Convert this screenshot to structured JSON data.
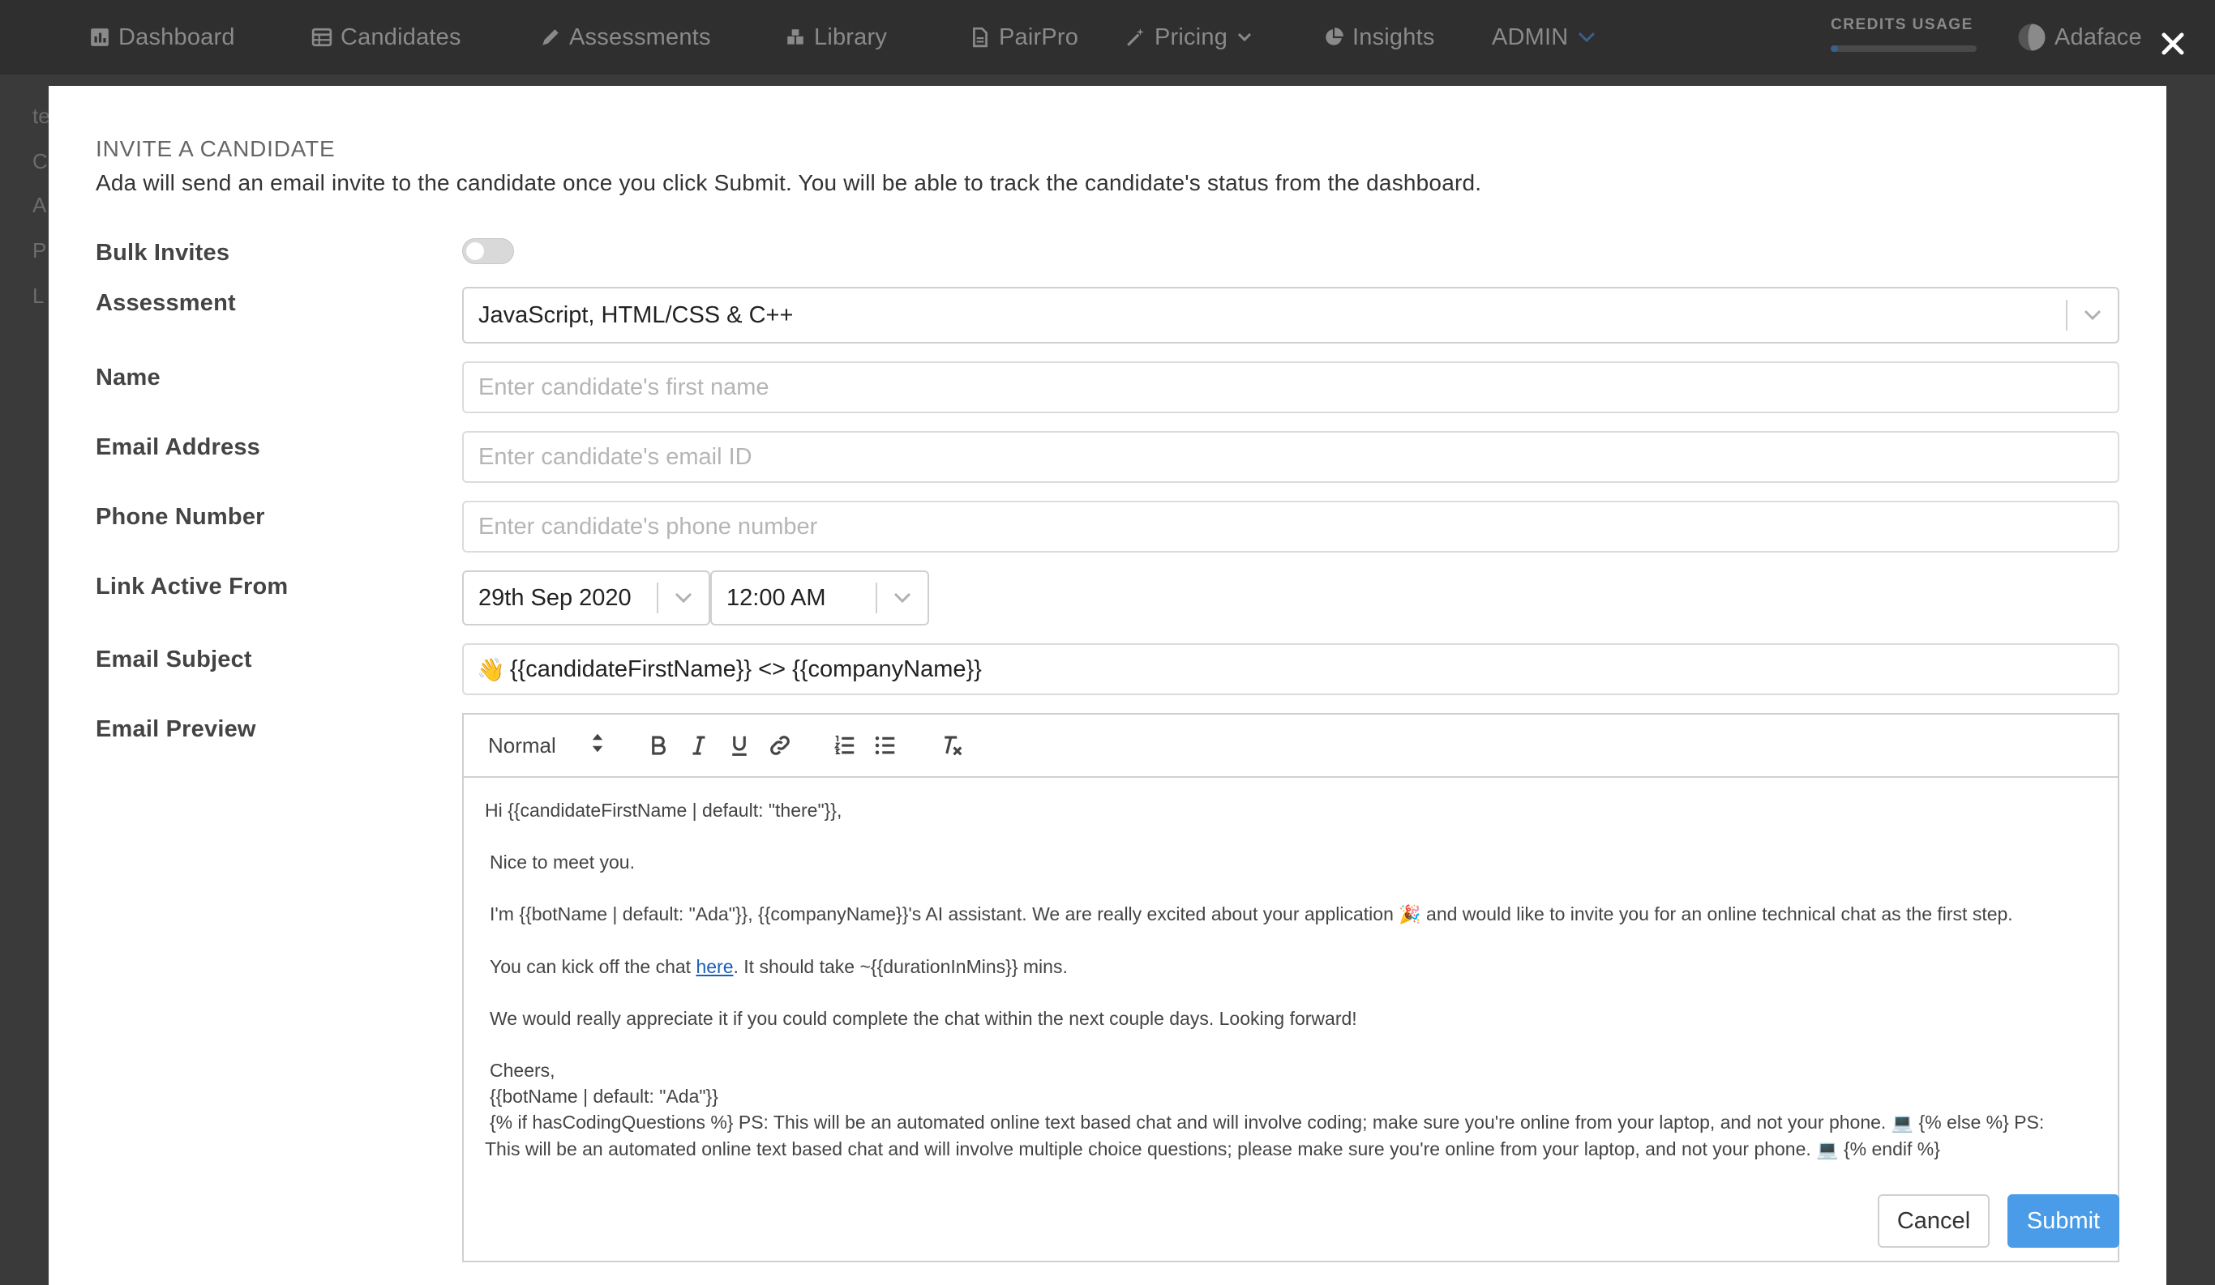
{
  "nav": {
    "items": [
      {
        "label": "Dashboard"
      },
      {
        "label": "Candidates"
      },
      {
        "label": "Assessments"
      },
      {
        "label": "Library"
      },
      {
        "label": "PairPro"
      },
      {
        "label": "Pricing"
      },
      {
        "label": "Insights"
      },
      {
        "label": "ADMIN"
      }
    ],
    "credits_label": "CREDITS USAGE",
    "credits_fraction": 0.05,
    "user": "Adaface"
  },
  "background_letters": [
    "te",
    "C",
    "A",
    "P",
    "L"
  ],
  "modal": {
    "title": "INVITE A CANDIDATE",
    "description": "Ada will send an email invite to the candidate once you click Submit. You will be able to track the candidate's status from the dashboard.",
    "labels": {
      "bulk": "Bulk Invites",
      "assessment": "Assessment",
      "name": "Name",
      "email": "Email Address",
      "phone": "Phone Number",
      "link_active": "Link Active From",
      "subject": "Email Subject",
      "preview": "Email Preview"
    },
    "bulk_enabled": false,
    "assessment_value": "JavaScript, HTML/CSS & C++",
    "name_placeholder": "Enter candidate's first name",
    "email_placeholder": "Enter candidate's email ID",
    "phone_placeholder": "Enter candidate's phone number",
    "date_value": "29th Sep 2020",
    "time_value": "12:00 AM",
    "subject_emoji": "👋",
    "subject_text": "{{candidateFirstName}} <> {{companyName}}",
    "editor": {
      "format": "Normal",
      "greeting": "Hi {{candidateFirstName | default: \"there\"}},",
      "line1": "Nice to meet you.",
      "line2a": "I'm {{botName | default: \"Ada\"}}, {{companyName}}'s AI assistant. We are really excited about your application ",
      "line2_emoji": "🎉",
      "line2b": " and would like to invite you for an online technical chat as the first step.",
      "line3a": "You can kick off the chat ",
      "line3_link": "here",
      "line3b": ". It should take ~{{durationInMins}} mins.",
      "line4": "We would really appreciate it if you could complete the chat within the next couple days. Looking forward!",
      "cheers": "Cheers,",
      "signature": "{{botName | default: \"Ada\"}}",
      "cond1a": "{% if hasCodingQuestions %} PS: This will be an automated online text based chat and will involve coding; make sure you're online from your laptop, and not your phone. ",
      "laptop_emoji": "💻",
      "cond1b": " {% else %} PS:",
      "cond2a": "This will be an automated online text based chat and will involve multiple choice questions; please make sure you're online from your laptop, and not your phone. ",
      "cond2b": " {% endif %}"
    },
    "cancel_label": "Cancel",
    "submit_label": "Submit"
  },
  "colors": {
    "accent": "#4a9ce8",
    "link": "#1a5fb4",
    "nav_bg": "#2f2f2f"
  }
}
